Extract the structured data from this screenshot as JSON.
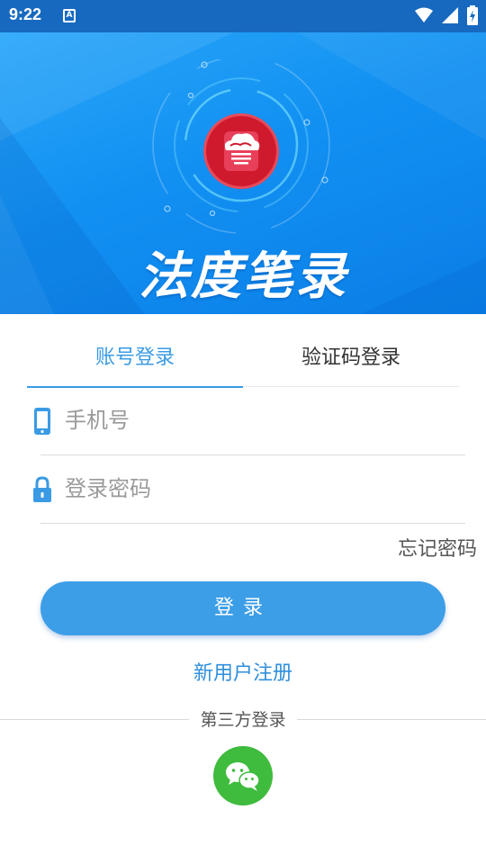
{
  "status_bar": {
    "time": "9:22",
    "notification_icon_letter": "A",
    "icons": [
      "wifi-icon",
      "signal-icon",
      "battery-charging-icon"
    ]
  },
  "hero": {
    "title": "法度笔录",
    "logo_icon": "cloud-scroll-logo-icon",
    "colors": {
      "background": "#1290f2",
      "logo_red": "#cf1a2e"
    }
  },
  "tabs": {
    "account_login": "账号登录",
    "sms_login": "验证码登录",
    "active": "account_login"
  },
  "form": {
    "phone_placeholder": "手机号",
    "phone_value": "",
    "password_placeholder": "登录密码",
    "password_value": "",
    "forgot_password": "忘记密码"
  },
  "actions": {
    "login_button": "登录",
    "register_link": "新用户注册"
  },
  "third_party": {
    "label": "第三方登录",
    "providers": [
      "wechat-icon"
    ]
  },
  "colors": {
    "accent": "#3a9be4",
    "button": "#3d9ee8",
    "wechat_green": "#3fbb3e"
  }
}
